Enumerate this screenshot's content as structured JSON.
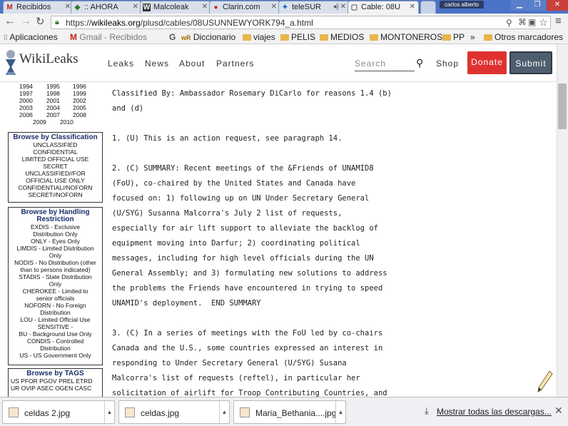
{
  "browser": {
    "tabs": [
      {
        "label": "Recibidos",
        "favicon": "M",
        "active": false
      },
      {
        "label": ":: AHORA",
        "favicon": "◆",
        "active": false
      },
      {
        "label": "Malcoleak",
        "favicon": "W",
        "active": false
      },
      {
        "label": "Clarin.com",
        "favicon": "●",
        "active": false
      },
      {
        "label": "teleSUR",
        "favicon": "✦",
        "active": false
      },
      {
        "label": "Cable: 08U",
        "favicon": "▢",
        "active": true
      }
    ],
    "profile_name": "carlos alberto",
    "url_prefix": "https://",
    "url_host": "wikileaks.org",
    "url_path": "/plusd/cables/08USUNNEWYORK794_a.html",
    "bookmarks": [
      {
        "label": "Aplicaciones",
        "icon": "apps-grid-icon"
      },
      {
        "label": "Gmail - Recibidos",
        "icon": "gmail-icon"
      },
      {
        "label": "Diccionario",
        "icon": "wr-icon"
      },
      {
        "label": "viajes",
        "icon": "folder-icon"
      },
      {
        "label": "PELIS",
        "icon": "folder-icon"
      },
      {
        "label": "MEDIOS",
        "icon": "folder-icon"
      },
      {
        "label": "MONTONEROS",
        "icon": "folder-icon"
      },
      {
        "label": "PP",
        "icon": "folder-icon"
      },
      {
        "label": "Otros marcadores",
        "icon": "folder-icon"
      }
    ],
    "overflow_glyph": "»",
    "mark_M": "M",
    "mark_G": "G",
    "mark_wr": "wR"
  },
  "site": {
    "logo": "WikiLeaks",
    "nav": [
      "Leaks",
      "News",
      "About",
      "Partners"
    ],
    "search_placeholder": "Search",
    "shop": "Shop",
    "donate": "Donate",
    "submit": "Submit",
    "colors": {
      "donate": "#e03131",
      "submit": "#4f5e6e"
    }
  },
  "sidebar": {
    "years": [
      [
        "1994",
        "1995",
        "1996"
      ],
      [
        "1997",
        "1998",
        "1999"
      ],
      [
        "2000",
        "2001",
        "2002"
      ],
      [
        "2003",
        "2004",
        "2005"
      ],
      [
        "2006",
        "2007",
        "2008"
      ],
      [
        "2009",
        "2010"
      ]
    ],
    "classification": {
      "title": "Browse by Classification",
      "items": [
        "UNCLASSIFIED",
        "CONFIDENTIAL",
        "LIMITED OFFICIAL USE",
        "SECRET",
        "UNCLASSIFIED//FOR",
        "OFFICIAL USE ONLY",
        "CONFIDENTIAL//NOFORN",
        "SECRET//NOFORN"
      ]
    },
    "handling": {
      "title_1": "Browse by Handling",
      "title_2": "Restriction",
      "items": [
        "EXDIS - Exclusive",
        "Distribution Only",
        "ONLY - Eyes Only",
        "LIMDIS - Limited Distribution",
        "Only",
        "NODIS - No Distribution (other",
        "than to persons indicated)",
        "STADIS - State Distribution",
        "Only",
        "CHEROKEE - Limited to",
        "senior officials",
        "NOFORN - No Foreign",
        "Distribution",
        "LOU - Limited Official Use",
        "SENSITIVE -",
        "BU - Background Use Only",
        "CONDIS - Controlled",
        "Distribution",
        "US - US Government Only"
      ]
    },
    "tags": {
      "title": "Browse by TAGS",
      "items": [
        "US PFOR PGOV PREL ETRD",
        "UR OVIP ASEC OGEN CASC"
      ]
    }
  },
  "cable_lines": [
    "Classified By: Ambassador Rosemary DiCarlo for reasons 1.4 (b)",
    "and (d)",
    "",
    "1. (U) This is an action request, see paragraph 14.",
    "",
    "2. (C) SUMMARY: Recent meetings of the &Friends of UNAMID8",
    "(FoU), co-chaired by the United States and Canada have",
    "focused on: 1) following up on UN Under Secretary General",
    "(U/SYG) Susanna Malcorra's July 2 list of requests,",
    "especially for air lift support to alleviate the backlog of",
    "equipment moving into Darfur; 2) coordinating political",
    "messages, including for high level officials during the UN",
    "General Assembly; and 3) formulating new solutions to address",
    "the problems the Friends have encountered in trying to speed",
    "UNAMID's deployment.  END SUMMARY",
    "",
    "3. (C) In a series of meetings with the FoU led by co-chairs",
    "Canada and the U.S., some countries expressed an interest in",
    "responding to Under Secretary General (U/SYG) Susana",
    "Malcorra's list of requests (reftel), in particular her",
    "solicitation of airlift for Troop Contributing Countries, and"
  ],
  "downloads": {
    "items": [
      "celdas 2.jpg",
      "celdas.jpg",
      "Maria_Bethania....jpg"
    ],
    "show_all": "Mostrar todas las descargas..."
  }
}
